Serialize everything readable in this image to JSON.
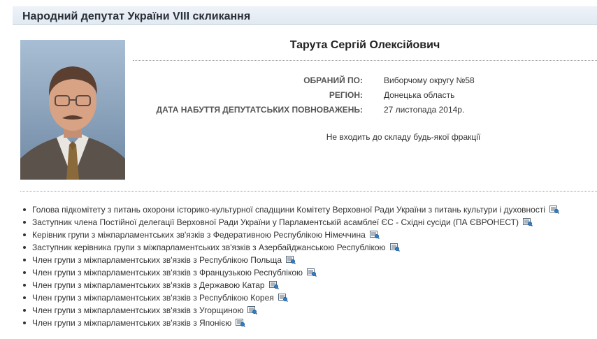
{
  "header": {
    "title": "Народний депутат України VIII скликання"
  },
  "deputy": {
    "name": "Тарута Сергій Олексійович",
    "photo_icon": "portrait-photo"
  },
  "info": [
    {
      "label": "ОБРАНИЙ ПО:",
      "value": "Виборчому округу №58"
    },
    {
      "label": "РЕГІОН:",
      "value": "Донецька область"
    },
    {
      "label": "ДАТА НАБУТТЯ ДЕПУТАТСЬКИХ ПОВНОВАЖЕНЬ:",
      "value": "27 листопада 2014р."
    }
  ],
  "faction": "Не входить до складу будь-якої фракції",
  "roles": [
    "Голова підкомітету з питань охорони історико-культурної спадщини Комітету Верховної Ради України з питань культури і духовності",
    "Заступник члена Постійної делегації Верховної Ради України у Парламентській асамблеї ЄС - Східні сусіди (ПА ЄВРОНЕСТ)",
    "Керівник групи з міжпарламентських зв'язків з Федеративною Республікою Німеччина",
    "Заступник керівника групи з міжпарламентських зв'язків з Азербайджанською Республікою",
    "Член групи з міжпарламентських зв'язків з Республікою Польща",
    "Член групи з міжпарламентських зв'язків з Французькою Республікою",
    "Член групи з міжпарламентських зв'язків з Державою Катар",
    "Член групи з міжпарламентських зв'язків з Республікою Корея",
    "Член групи з міжпарламентських зв'язків з Угорщиною",
    "Член групи з міжпарламентських зв'язків з Японією"
  ],
  "role_icon": "document-search-icon"
}
